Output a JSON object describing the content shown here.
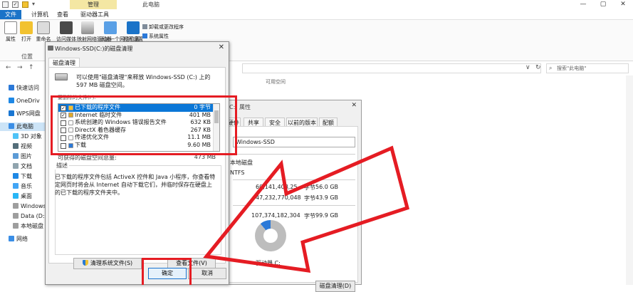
{
  "window": {
    "tool_tab": "管理",
    "title": "此电脑",
    "minimize_glyph": "—",
    "maximize_glyph": "▢",
    "close_glyph": "✕"
  },
  "ribbon": {
    "tabs": [
      "文件",
      "计算机",
      "查看",
      "驱动器工具"
    ],
    "buttons": [
      "属性",
      "打开",
      "重命名",
      "访问媒体",
      "映射网络驱动器",
      "添加一个网络位置",
      "打开设置"
    ],
    "small_items": [
      "卸载或更改程序",
      "系统属性"
    ],
    "group_label": "位置"
  },
  "nav": {
    "search_placeholder": "搜索\"此电脑\"",
    "back": "←",
    "forward": "→",
    "up": "↑",
    "refresh": "↻",
    "dropdown": "∨"
  },
  "sidebar": {
    "items": [
      "快速访问",
      "OneDriv",
      "WPS网盘",
      "此电脑",
      "3D 对象",
      "视频",
      "图片",
      "文档",
      "下载",
      "音乐",
      "桌面",
      "Windows-",
      "Data (D:)",
      "本地磁盘",
      "网络"
    ]
  },
  "main": {
    "free_space_header": "可用空间"
  },
  "properties": {
    "title_fragment": "C:) 属性",
    "tabs": [
      "硬件",
      "共享",
      "安全",
      "以前的版本",
      "配额"
    ],
    "name_value": "Windows-SSD",
    "type_value": "本地磁盘",
    "fs_value": "NTFS",
    "used_bytes": "60,141,408,25",
    "used_unit": "字节",
    "used_gb": "56.0 GB",
    "free_bytes": "47,232,770,048",
    "free_unit": "字节",
    "free_gb": "43.9 GB",
    "cap_bytes": "107,374,182,304",
    "cap_unit": "字节",
    "cap_gb": "99.9 GB",
    "drive_label": "驱动器 C:",
    "cleanup_button": "磁盘清理(D)"
  },
  "dialog": {
    "title": "Windows-SSD(C:)的磁盘清理",
    "close_glyph": "✕",
    "tab": "磁盘清理",
    "intro": "可以使用\"磁盘清理\"来释放 Windows-SSD (C:) 上的 597 MB 磁盘空间。",
    "list_label": "要删除的文件(F):",
    "files": [
      {
        "name": "已下载的程序文件",
        "size": "0 字节",
        "checked": true,
        "selected": true,
        "icon_color": "#f2c230"
      },
      {
        "name": "Internet 临时文件",
        "size": "401 MB",
        "checked": true,
        "selected": false,
        "icon_color": "#e0a92a"
      },
      {
        "name": "系统创建的 Windows 错误报告文件",
        "size": "632 KB",
        "checked": false,
        "selected": false,
        "icon_color": "#ffffff"
      },
      {
        "name": "DirectX 着色器缓存",
        "size": "267 KB",
        "checked": false,
        "selected": false,
        "icon_color": "#ffffff"
      },
      {
        "name": "传递优化文件",
        "size": "11.1 MB",
        "checked": false,
        "selected": false,
        "icon_color": "#ffffff"
      },
      {
        "name": "下载",
        "size": "9.60 MB",
        "checked": false,
        "selected": false,
        "icon_color": "#2b79d8"
      }
    ],
    "space_gain_label": "可获得的磁盘空间总量:",
    "space_gain_value": "473 MB",
    "desc_label": "描述",
    "description": "已下载的程序文件包括 ActiveX 控件和 Java 小程序，你查看特定网页时将会从 Internet 自动下载它们，并临时保存在硬盘上的已下载的程序文件夹中。",
    "btn_system": "清理系统文件(S)",
    "btn_view": "查看文件(V)",
    "btn_ok": "确定",
    "btn_cancel": "取消"
  },
  "colors": {
    "annotation_red": "#e51c23",
    "selection_blue": "#0b77d7",
    "file_tab_blue": "#1a73c8",
    "tool_tab_yellow": "#f4e7a3"
  }
}
